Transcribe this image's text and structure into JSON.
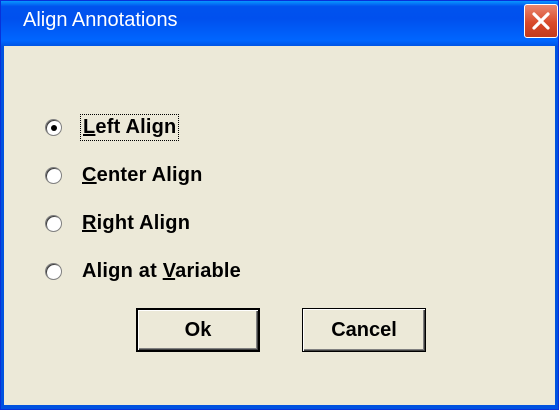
{
  "window": {
    "title": "Align Annotations",
    "close_icon": "close-icon"
  },
  "options": [
    {
      "prefix": "",
      "mnemonic": "L",
      "suffix": "eft Align",
      "selected": true
    },
    {
      "prefix": "",
      "mnemonic": "C",
      "suffix": "enter Align",
      "selected": false
    },
    {
      "prefix": "",
      "mnemonic": "R",
      "suffix": "ight Align",
      "selected": false
    },
    {
      "prefix": "Align at ",
      "mnemonic": "V",
      "suffix": "ariable",
      "selected": false
    }
  ],
  "buttons": {
    "ok_label": "Ok",
    "cancel_label": "Cancel"
  },
  "colors": {
    "titlebar": "#0055e5",
    "dialog_bg": "#ece9d8",
    "close": "#d94a2b"
  }
}
